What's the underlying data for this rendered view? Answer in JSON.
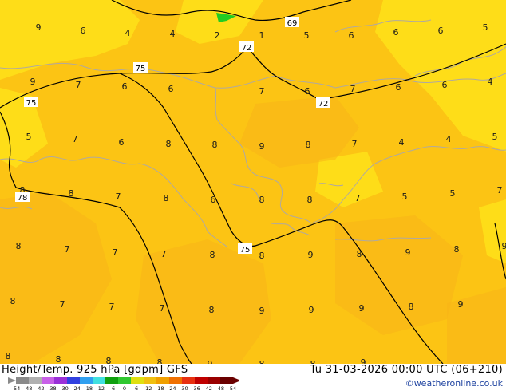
{
  "footer": {
    "title": "Height/Temp. 925 hPa [gdpm] GFS",
    "datetime": "Tu 31-03-2026 00:00 UTC (06+210)",
    "credit": "©weatheronline.co.uk"
  },
  "colorbar": {
    "ticks": [
      "-54",
      "-48",
      "-42",
      "-38",
      "-30",
      "-24",
      "-18",
      "-12",
      "-6",
      "0",
      "6",
      "12",
      "18",
      "24",
      "30",
      "36",
      "42",
      "48",
      "54"
    ],
    "colors": [
      "#8a8a8a",
      "#b0b0b0",
      "#c860e8",
      "#9a30d8",
      "#3040e0",
      "#30a0f0",
      "#40e0e0",
      "#10a010",
      "#30c830",
      "#e0e010",
      "#f0c010",
      "#f0a000",
      "#f07000",
      "#e83010",
      "#c00000",
      "#9a0000",
      "#6a0000"
    ]
  },
  "map": {
    "colors": {
      "base": "#fcc414",
      "bright": "#ffe81a",
      "orange": "#f8b418",
      "green_spot": "#22cc22",
      "coast": "#b0a9a0",
      "contour": "#000000"
    },
    "contour_labels": [
      "69",
      "72",
      "72",
      "75",
      "75",
      "75",
      "78"
    ],
    "temps": [
      "9",
      "6",
      "4",
      "4",
      "2",
      "1",
      "5",
      "6",
      "6",
      "6",
      "5",
      "9",
      "7",
      "6",
      "6",
      "7",
      "6",
      "7",
      "6",
      "6",
      "4",
      "5",
      "7",
      "6",
      "8",
      "8",
      "9",
      "8",
      "7",
      "4",
      "4",
      "5",
      "8",
      "8",
      "7",
      "8",
      "6",
      "8",
      "8",
      "7",
      "5",
      "5",
      "7",
      "8",
      "7",
      "7",
      "7",
      "8",
      "8",
      "9",
      "8",
      "9",
      "8",
      "9",
      "8",
      "7",
      "7",
      "7",
      "8",
      "9",
      "9",
      "9",
      "8",
      "9",
      "8",
      "8",
      "8",
      "8",
      "9",
      "8",
      "8",
      "9"
    ]
  }
}
